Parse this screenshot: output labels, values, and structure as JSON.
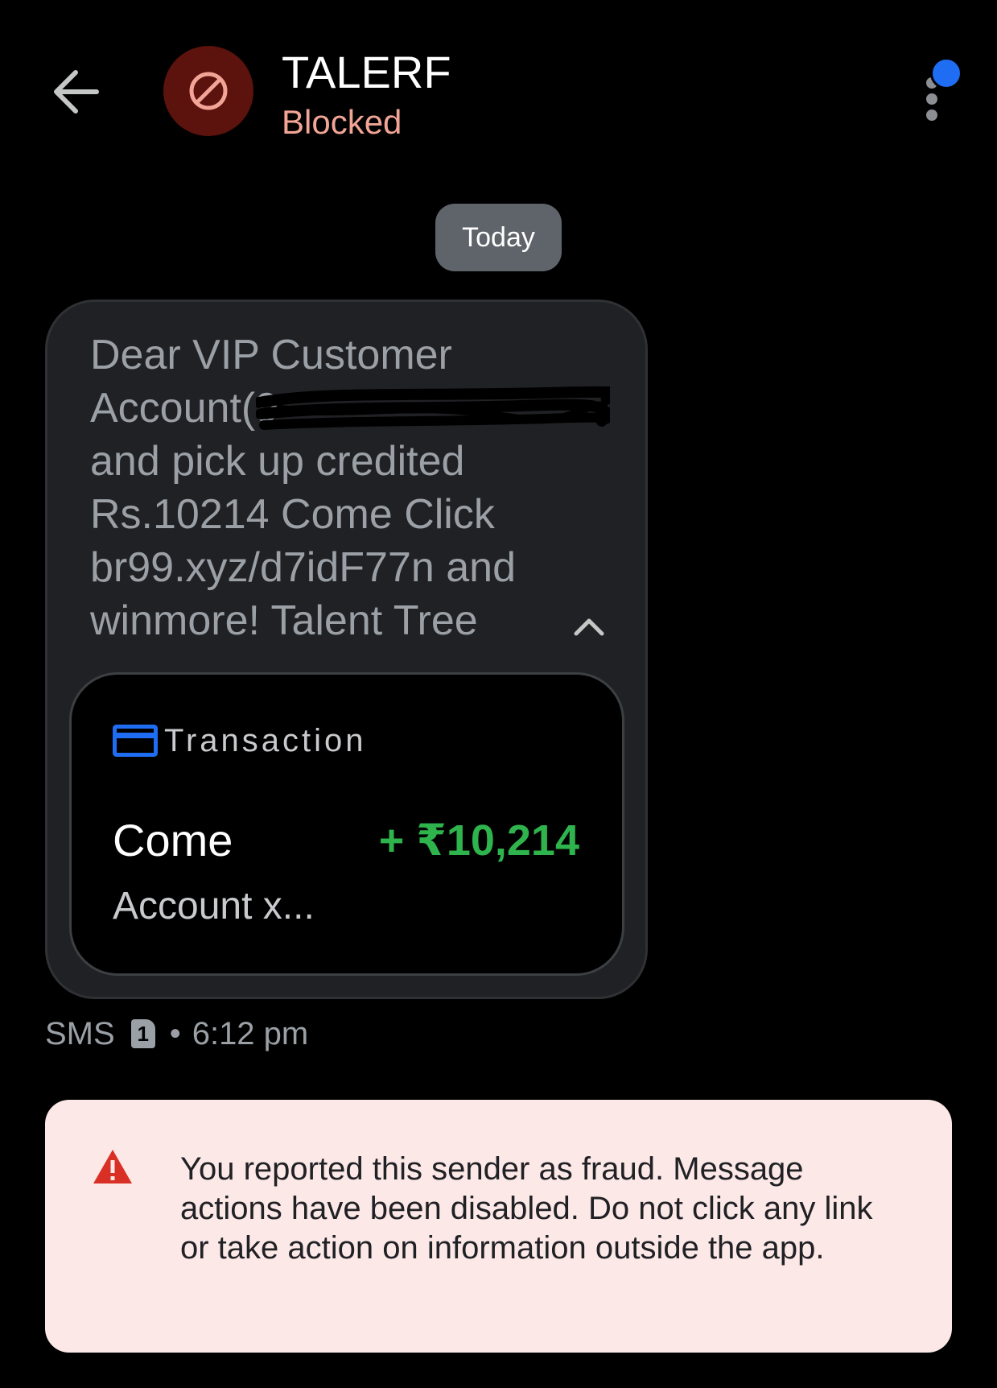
{
  "header": {
    "back_icon": "arrow-left-icon",
    "avatar_icon": "blocked-icon",
    "title": "TALERF",
    "subtitle": "Blocked",
    "more_icon": "more-vertical-icon",
    "notification_badge_color": "#1f6df2"
  },
  "date_chip": "Today",
  "message": {
    "text": "Dear VIP Customer\nAccount(9\nand pick up credited\nRs.10214 Come Click\nbr99.xyz/d7idF77n and\nwinmore! Talent Tree",
    "collapse_icon": "chevron-up-icon",
    "transaction": {
      "icon": "credit-card-icon",
      "label": "Transaction",
      "name": "Come",
      "amount": "+ ₹10,214",
      "account": "Account x...",
      "amount_color": "#2fb34c"
    },
    "meta": {
      "type": "SMS",
      "sim": "1",
      "separator": "•",
      "time": "6:12 pm"
    }
  },
  "warning": {
    "icon": "warning-icon",
    "text": "You reported this sender as fraud. Message actions have been disabled. Do not click any link or take action on information outside the app."
  },
  "colors": {
    "background": "#000000",
    "bubble": "#202124",
    "blocked_accent": "#f2a596",
    "warning_bg": "#fde8e8",
    "warning_icon": "#d93025"
  }
}
